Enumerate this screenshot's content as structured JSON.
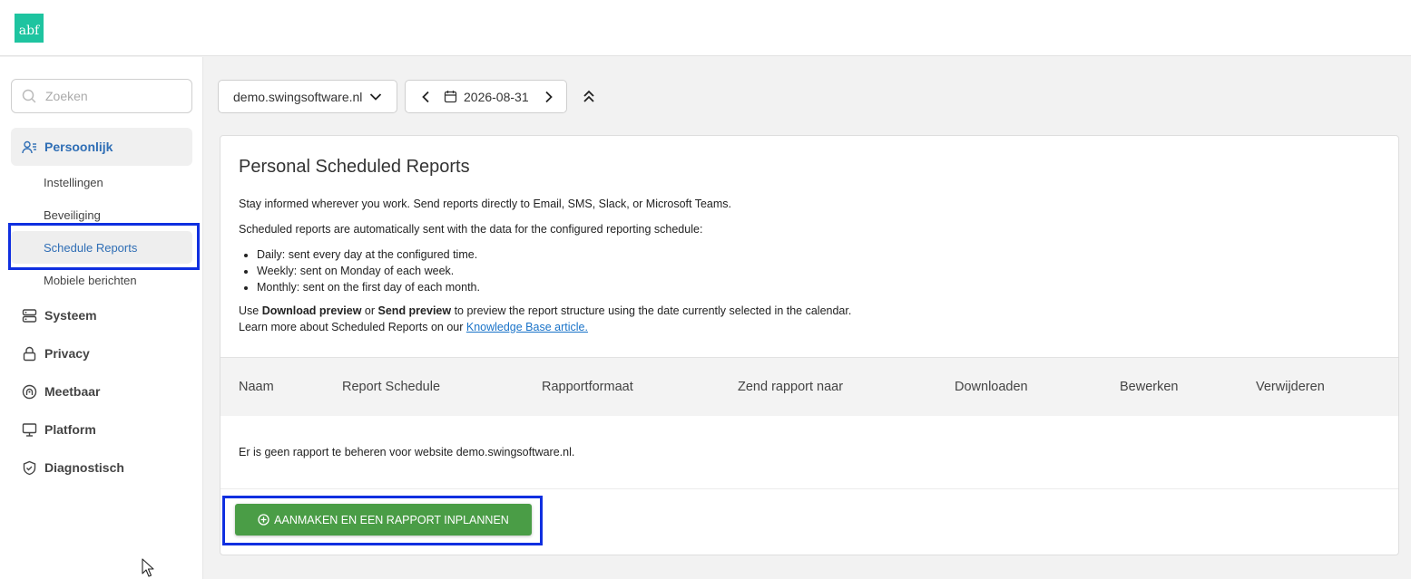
{
  "logo": {
    "text": "abf",
    "color": "#1ec4a0"
  },
  "search": {
    "placeholder": "Zoeken",
    "icon": "search-icon"
  },
  "sidebar": {
    "groups": [
      {
        "label": "Persoonlijk",
        "icon": "user-list-icon",
        "active": true
      },
      {
        "label": "Systeem",
        "icon": "server-icon"
      },
      {
        "label": "Privacy",
        "icon": "lock-icon"
      },
      {
        "label": "Meetbaar",
        "icon": "measurable-icon"
      },
      {
        "label": "Platform",
        "icon": "monitor-icon"
      },
      {
        "label": "Diagnostisch",
        "icon": "shield-check-icon"
      }
    ],
    "subitems": [
      {
        "label": "Instellingen"
      },
      {
        "label": "Beveiliging"
      },
      {
        "label": "Schedule Reports",
        "active": true
      },
      {
        "label": "Mobiele berichten"
      }
    ]
  },
  "toolbar": {
    "website": "demo.swingsoftware.nl",
    "date": "2026-08-31"
  },
  "card": {
    "title": "Personal Scheduled Reports",
    "intro1": "Stay informed wherever you work. Send reports directly to Email, SMS, Slack, or Microsoft Teams.",
    "intro2": "Scheduled reports are automatically sent with the data for the configured reporting schedule:",
    "bullets": [
      "Daily: sent every day at the configured time.",
      "Weekly: sent on Monday of each week.",
      "Monthly: sent on the first day of each month."
    ],
    "use_prefix": "Use ",
    "download_preview": "Download preview",
    "or": " or ",
    "send_preview": "Send preview",
    "use_suffix": " to preview the report structure using the date currently selected in the calendar.",
    "learn_prefix": "Learn more about Scheduled Reports on our ",
    "kb_link": "Knowledge Base article."
  },
  "table": {
    "columns": [
      "Naam",
      "Report Schedule",
      "Rapportformaat",
      "Zend rapport naar",
      "Downloaden",
      "Bewerken",
      "Verwijderen"
    ],
    "empty_message": "Er is geen rapport te beheren voor website demo.swingsoftware.nl."
  },
  "create_button": {
    "label": "AANMAKEN EN EEN RAPPORT INPLANNEN",
    "icon": "plus-circle-icon",
    "color": "#4a9d46"
  },
  "accent_color": "#2f6eb5",
  "highlight_color": "#0f2fe0"
}
